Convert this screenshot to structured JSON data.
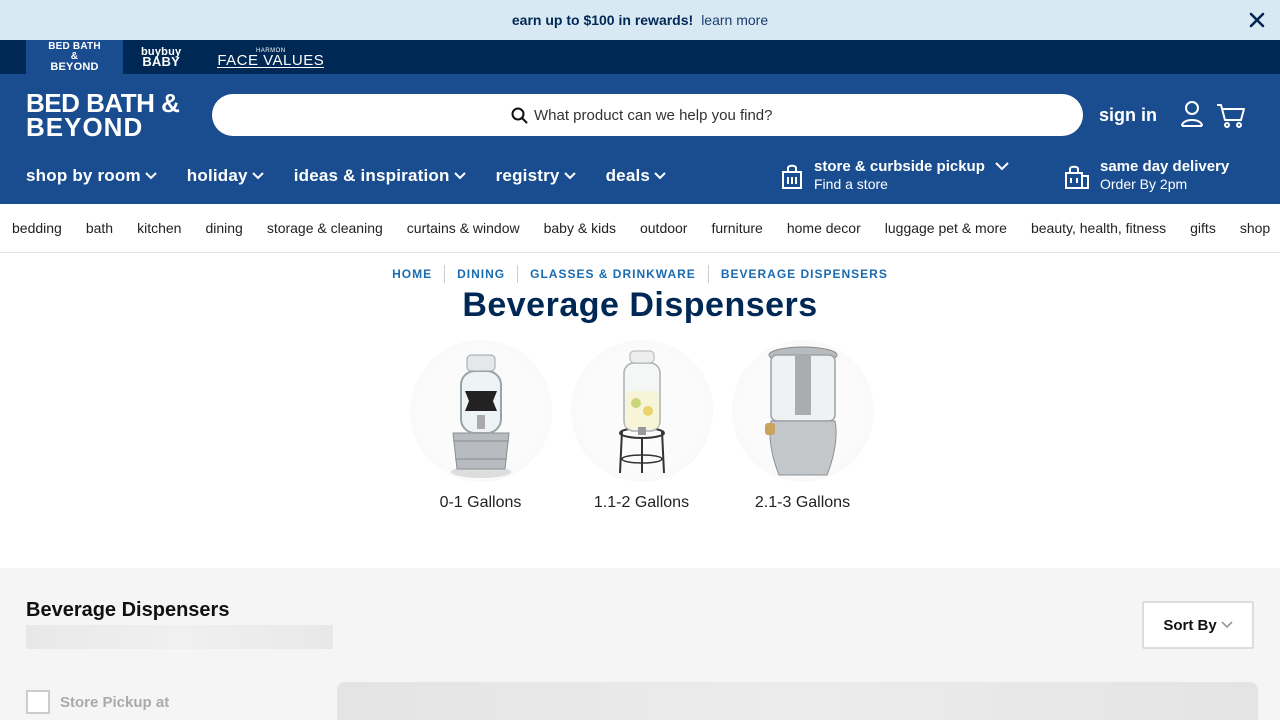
{
  "promo": {
    "bold_text": "earn up to $100 in rewards!",
    "link_text": "learn more"
  },
  "brands": {
    "bbb_line1": "BED BATH &",
    "bbb_line2": "BEYOND",
    "baby_line1": "buybuy",
    "baby_line2": "BABY",
    "fv_small": "HARMON",
    "fv_main": "FACE VALUES"
  },
  "header": {
    "logo_line1": "BED BATH &",
    "logo_line2": "BEYOND",
    "search_placeholder": "What product can we help you find?",
    "sign_in": "sign in"
  },
  "nav": {
    "items": [
      {
        "label": "shop by room"
      },
      {
        "label": "holiday"
      },
      {
        "label": "ideas & inspiration"
      },
      {
        "label": "registry"
      },
      {
        "label": "deals"
      }
    ],
    "store_title": "store & curbside pickup",
    "store_sub": "Find a store",
    "sdd_title": "same day delivery",
    "sdd_sub": "Order By 2pm"
  },
  "categories": [
    "bedding",
    "bath",
    "kitchen",
    "dining",
    "storage & cleaning",
    "curtains & window",
    "baby & kids",
    "outdoor",
    "furniture",
    "home decor",
    "luggage pet & more",
    "beauty, health, fitness",
    "gifts",
    "shop"
  ],
  "breadcrumb": [
    "HOME",
    "DINING",
    "GLASSES & DRINKWARE",
    "BEVERAGE DISPENSERS"
  ],
  "page_title": "Beverage Dispensers",
  "subcategories": [
    {
      "label": "0-1 Gallons"
    },
    {
      "label": "1.1-2 Gallons"
    },
    {
      "label": "2.1-3 Gallons"
    }
  ],
  "results": {
    "title": "Beverage Dispensers",
    "sort_label": "Sort By",
    "store_pickup_label": "Store Pickup at"
  },
  "colors": {
    "navy": "#002855",
    "brand_blue": "#1a4d8f",
    "promo_bg": "#d9e9f4",
    "link_blue": "#1a6bb0"
  }
}
